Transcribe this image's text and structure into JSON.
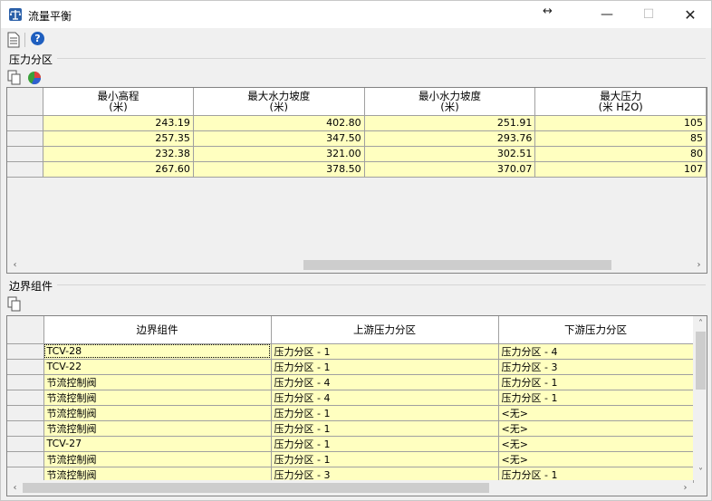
{
  "window": {
    "title": "流量平衡"
  },
  "pressure_zones": {
    "title": "压力分区",
    "columns": [
      {
        "name": "最小高程",
        "unit": "(米)"
      },
      {
        "name": "最大水力坡度",
        "unit": "(米)"
      },
      {
        "name": "最小水力坡度",
        "unit": "(米)"
      },
      {
        "name": "最大压力",
        "unit": "(米 H2O)"
      }
    ],
    "rows": [
      [
        "243.19",
        "402.80",
        "251.91",
        "105"
      ],
      [
        "257.35",
        "347.50",
        "293.76",
        "85"
      ],
      [
        "232.38",
        "321.00",
        "302.51",
        "80"
      ],
      [
        "267.60",
        "378.50",
        "370.07",
        "107"
      ]
    ]
  },
  "boundary": {
    "title": "边界组件",
    "columns": [
      "边界组件",
      "上游压力分区",
      "下游压力分区"
    ],
    "rows": [
      [
        "TCV-28",
        "压力分区 - 1",
        "压力分区 - 4"
      ],
      [
        "TCV-22",
        "压力分区 - 1",
        "压力分区 - 3"
      ],
      [
        "节流控制阀",
        "压力分区 - 4",
        "压力分区 - 1"
      ],
      [
        "节流控制阀",
        "压力分区 - 4",
        "压力分区 - 1"
      ],
      [
        "节流控制阀",
        "压力分区 - 1",
        "<无>"
      ],
      [
        "节流控制阀",
        "压力分区 - 1",
        "<无>"
      ],
      [
        "TCV-27",
        "压力分区 - 1",
        "<无>"
      ],
      [
        "节流控制阀",
        "压力分区 - 1",
        "<无>"
      ],
      [
        "节流控制阀",
        "压力分区 - 3",
        "压力分区 - 1"
      ]
    ]
  },
  "icons": {
    "app": "balance-scale-icon",
    "report": "report-icon",
    "help": "help-icon",
    "copy": "copy-icon",
    "chart": "pie-chart-icon"
  },
  "colors": {
    "cell_bg": "#ffffc0",
    "help_blue": "#1f5fbf"
  }
}
